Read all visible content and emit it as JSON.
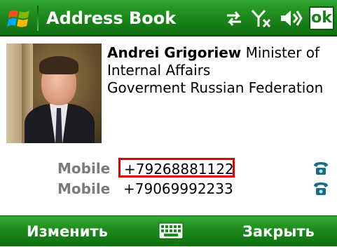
{
  "titlebar": {
    "title": "Address Book",
    "ok_label": "ok",
    "icons": [
      "windows-start-icon",
      "sync-arrows-icon",
      "no-signal-antenna-icon",
      "volume-icon"
    ]
  },
  "contact": {
    "name": "Andrei Grigoriew",
    "title_part1": "Minister of",
    "title_part2": "Internal Affairs",
    "company": "Goverment Russian Federation",
    "photo": "contact-photo"
  },
  "phones": [
    {
      "label": "Mobile",
      "number": "+79268881122",
      "highlighted": true,
      "icon": "phone-icon"
    },
    {
      "label": "Mobile",
      "number": "+79069992233",
      "highlighted": false,
      "icon": "phone-icon"
    }
  ],
  "softkeys": {
    "left": "Изменить",
    "center_icon": "keyboard-icon",
    "right": "Закрыть"
  },
  "colors": {
    "bar_green": "#1d8a1d",
    "highlight_red": "#e00000",
    "label_gray": "#7a7a7a"
  }
}
